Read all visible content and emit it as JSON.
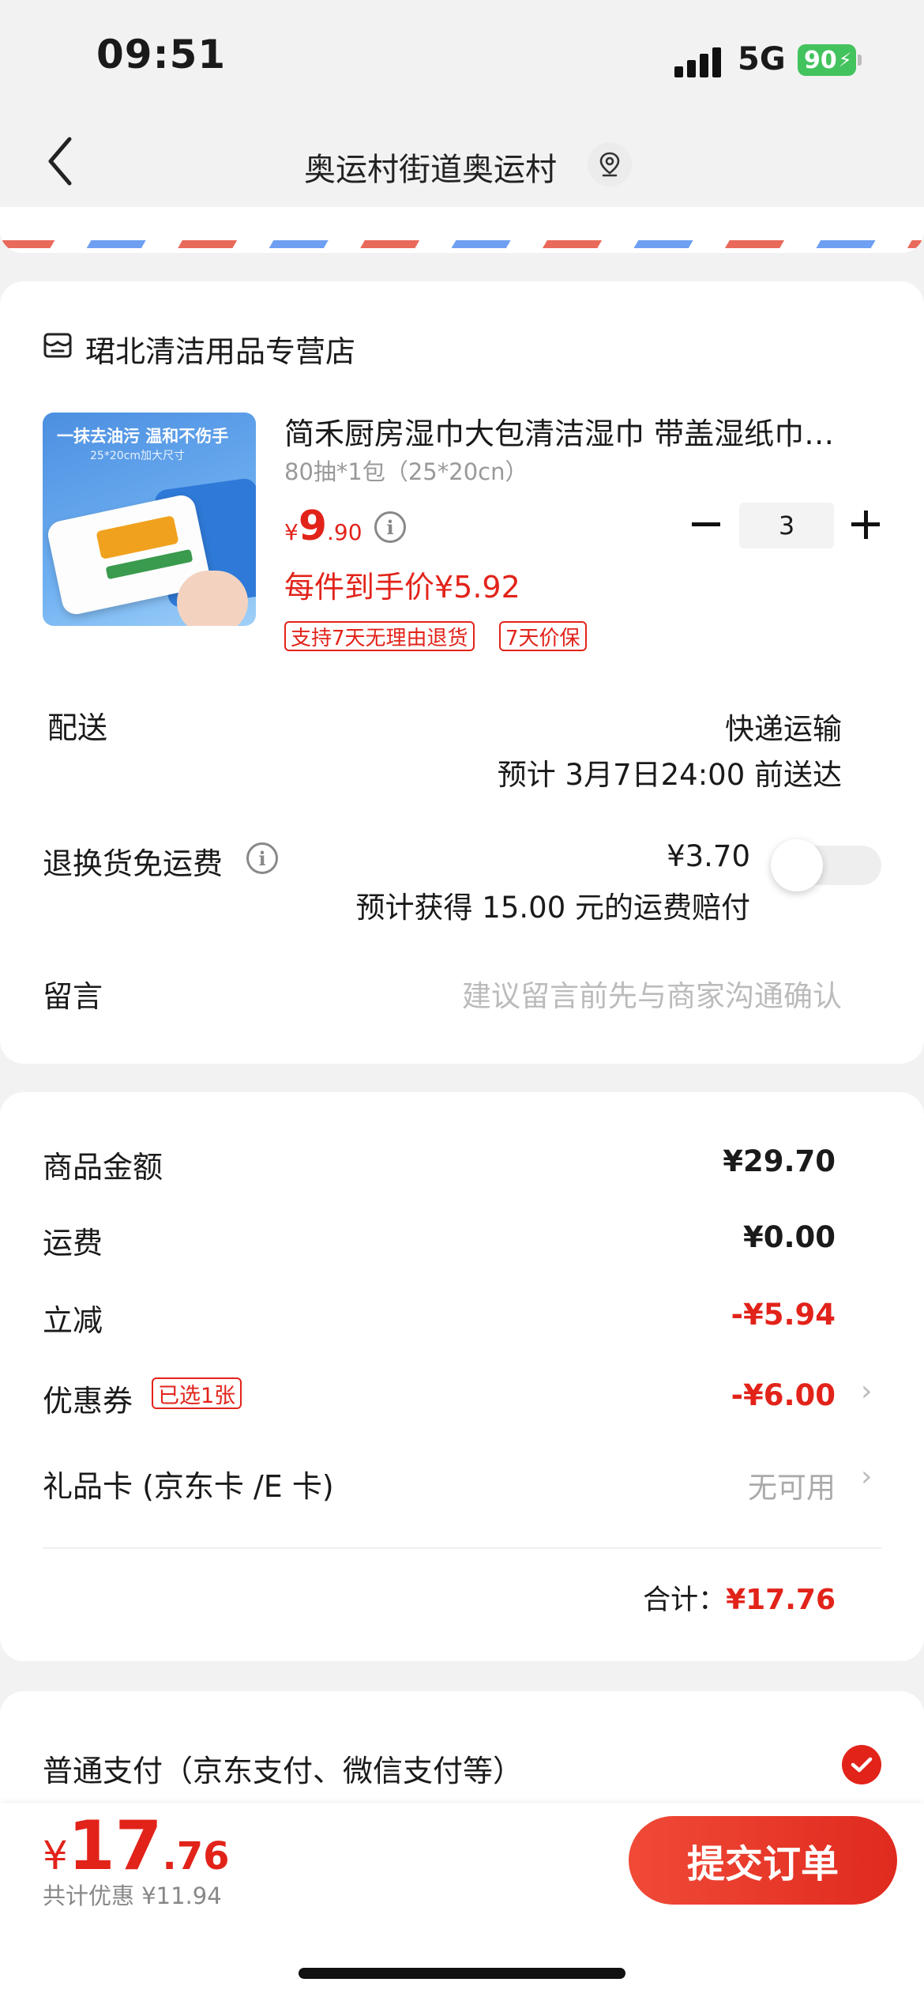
{
  "status": {
    "time": "09:51",
    "network": "5G",
    "battery": "90"
  },
  "header": {
    "title": "奥运村街道奥运村"
  },
  "store": {
    "name": "珺北清洁用品专营店"
  },
  "product": {
    "image_text": {
      "line1": "一抹去油污 温和不伤手",
      "line2": "25*20cm加大尺寸"
    },
    "title": "简禾厨房湿巾大包清洁湿巾 带盖湿纸巾…",
    "spec": "80抽*1包（25*20cn）",
    "price": {
      "currency": "¥",
      "integer": "9",
      "decimal": ".90"
    },
    "unit_price": "每件到手价¥5.92",
    "tags": [
      "支持7天无理由退货",
      "7天价保"
    ],
    "quantity": "3"
  },
  "delivery": {
    "label": "配送",
    "method": "快递运输",
    "eta": "预计 3月7日24:00 前送达"
  },
  "return_shipping": {
    "label": "退换货免运费",
    "price": "¥3.70",
    "note": "预计获得 15.00 元的运费赔付",
    "enabled": false
  },
  "message": {
    "label": "留言",
    "placeholder": "建议留言前先与商家沟通确认"
  },
  "summary": {
    "goods_label": "商品金额",
    "goods_value": "¥29.70",
    "shipping_label": "运费",
    "shipping_value": "¥0.00",
    "discount_label": "立减",
    "discount_value": "-¥5.94",
    "coupon_label": "优惠券",
    "coupon_badge": "已选1张",
    "coupon_value": "-¥6.00",
    "giftcard_label": "礼品卡 (京东卡 /E 卡)",
    "giftcard_value": "无可用",
    "total_label": "合计：",
    "total_value": "¥17.76"
  },
  "payment": {
    "label": "普通支付（京东支付、微信支付等）",
    "selected": true
  },
  "bottom": {
    "total": {
      "currency": "¥",
      "integer": "17",
      "decimal": ".76"
    },
    "saved": "共计优惠 ¥11.94",
    "submit": "提交订单"
  },
  "colors": {
    "accent": "#e2231a",
    "background": "#f2f2f2"
  }
}
